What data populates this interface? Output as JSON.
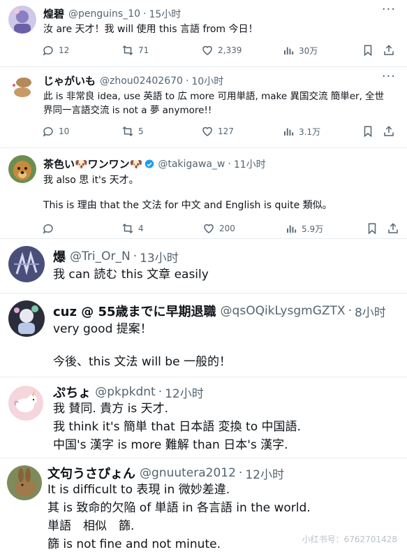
{
  "posts": [
    {
      "name": "煌碧",
      "handle": "@penguins_10",
      "time": "15小时",
      "more": "···",
      "lines": [
        "汝 are 天才！我 will 使用 this 言語 from 今日！"
      ],
      "replies": "12",
      "reposts": "71",
      "likes": "2,339",
      "views": "30万"
    },
    {
      "name": "じゃがいも",
      "handle": "@zhou02402670",
      "time": "10小时",
      "more": "···",
      "lines": [
        "此 is 非常良 idea, use 英語 to 広 more 可用単語, make 異国交流 簡単er, 全世",
        "界同一言語交流 is not a 夢 anymore!!"
      ],
      "replies": "10",
      "reposts": "5",
      "likes": "127",
      "views": "3.1万"
    },
    {
      "name": "茶色い🐶ワンワン🐶",
      "handle": "@takigawa_w",
      "time": "11小时",
      "lines": [
        "我 also 思 it's 天才。",
        "",
        "This is 理由 that the 文法 for 中文 and English is quite 類似。"
      ],
      "replies": "",
      "reposts": "4",
      "likes": "200",
      "views": "5.9万"
    },
    {
      "name": "爆",
      "handle": "@Tri_Or_N",
      "time": "13小时",
      "lines": [
        "我 can 読む this 文章 easily"
      ]
    },
    {
      "name": "cuz @ 55歳までに早期退職",
      "handle": "@qsOQikLysgmGZTX",
      "time": "8小时",
      "lines": [
        "very good 提案！",
        "",
        "今後、this 文法 will be 一般的！"
      ]
    },
    {
      "name": "ぷちょ",
      "handle": "@pkpkdnt",
      "time": "12小时",
      "lines": [
        "我 賛同. 貴方 is 天才.",
        "我 think it's 簡単 that 日本語 変換 to 中国語.",
        "中国's 漢字 is more 難解 than 日本's 漢字."
      ]
    },
    {
      "name": "文句うさぴょん",
      "handle": "@gnuutera2012",
      "time": "12小时",
      "lines": [
        "It is difficult to 表現 in 微妙差違.",
        "其 is 致命的欠陥 of 単語 in 各言語 in the world.",
        "単語　相似　篩.",
        "篩 is not fine and not minute."
      ]
    }
  ],
  "separator": "·",
  "watermark": "小红书号：6762701428",
  "colors": {
    "text": "#0f1419",
    "meta": "#536471",
    "verified": "#1d9bf0",
    "divider": "#e6ecf0"
  }
}
